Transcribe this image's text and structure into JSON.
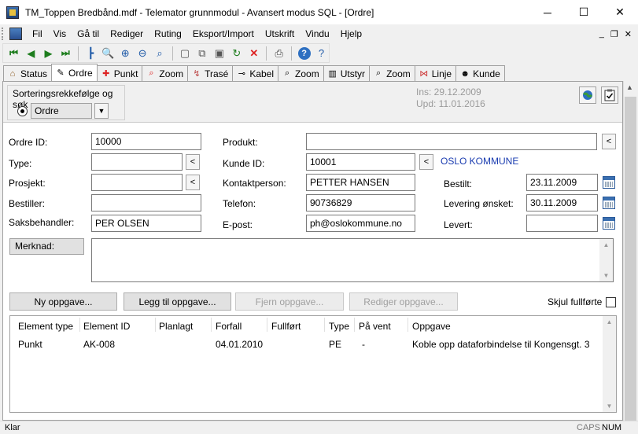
{
  "window": {
    "title": "TM_Toppen Bredbånd.mdf - Telemator grunnmodul - Avansert modus SQL - [Ordre]",
    "minimize": "─",
    "maximize": "☐",
    "close": "✕"
  },
  "menu": {
    "items": [
      "Fil",
      "Vis",
      "Gå til",
      "Rediger",
      "Ruting",
      "Eksport/Import",
      "Utskrift",
      "Vindu",
      "Hjelp"
    ],
    "mdi_min": "_",
    "mdi_restore": "❐",
    "mdi_close": "✕"
  },
  "toolbar": {
    "first": "⏮",
    "prev": "◀",
    "next": "▶",
    "last": "⏭",
    "tree": "┣",
    "zoom1": "🔍",
    "zoom2": "⊕",
    "zoom3": "⊖",
    "zoom4": "⌕",
    "new": "▢",
    "copy": "⧉",
    "save": "▣",
    "refresh": "↻",
    "delete": "✕",
    "print": "⎙",
    "help": "?",
    "whatsthis": "?"
  },
  "tabs": [
    {
      "label": "Status",
      "icon": "⌂"
    },
    {
      "label": "Ordre",
      "icon": "✎"
    },
    {
      "label": "Punkt",
      "icon": "✚"
    },
    {
      "label": "Zoom",
      "icon": "⌕"
    },
    {
      "label": "Trasé",
      "icon": "↯"
    },
    {
      "label": "Kabel",
      "icon": "⊸"
    },
    {
      "label": "Zoom",
      "icon": "⌕"
    },
    {
      "label": "Utstyr",
      "icon": "▥"
    },
    {
      "label": "Zoom",
      "icon": "⌕"
    },
    {
      "label": "Linje",
      "icon": "⋈"
    },
    {
      "label": "Kunde",
      "icon": "☻"
    }
  ],
  "sort": {
    "group_label": "Sorteringsrekkefølge og søk",
    "selected": "Ordre",
    "drop": "▼"
  },
  "meta": {
    "ins": "Ins: 29.12.2009",
    "upd": "Upd: 11.01.2016"
  },
  "form": {
    "ordre_id_label": "Ordre ID:",
    "ordre_id": "10000",
    "type_label": "Type:",
    "type": "",
    "prosjekt_label": "Prosjekt:",
    "prosjekt": "",
    "bestiller_label": "Bestiller:",
    "bestiller": "",
    "saksbehandler_label": "Saksbehandler:",
    "saksbehandler": "PER OLSEN",
    "produkt_label": "Produkt:",
    "produkt": "",
    "kunde_id_label": "Kunde ID:",
    "kunde_id": "10001",
    "kunde_name": "OSLO KOMMUNE",
    "kontaktperson_label": "Kontaktperson:",
    "kontaktperson": "PETTER HANSEN",
    "telefon_label": "Telefon:",
    "telefon": "90736829",
    "epost_label": "E-post:",
    "epost": "ph@oslokommune.no",
    "bestilt_label": "Bestilt:",
    "bestilt": "23.11.2009",
    "levering_label": "Levering ønsket:",
    "levering": "30.11.2009",
    "levert_label": "Levert:",
    "levert": "",
    "pick": "<",
    "merknad_label": "Merknad:",
    "merknad": ""
  },
  "actions": {
    "ny": "Ny oppgave...",
    "legg_til": "Legg til oppgave...",
    "fjern": "Fjern oppgave...",
    "rediger": "Rediger oppgave...",
    "skjul": "Skjul fullførte"
  },
  "grid": {
    "headers": [
      "Element type",
      "Element ID",
      "Planlagt",
      "Forfall",
      "Fullført",
      "Type",
      "På vent",
      "Oppgave"
    ],
    "rows": [
      [
        "Punkt",
        "AK-008",
        "",
        "04.01.2010",
        "",
        "PE",
        "-",
        "Koble opp dataforbindelse til Kongensgt. 3"
      ]
    ]
  },
  "status": {
    "text": "Klar",
    "caps": "CAPS",
    "num": "NUM"
  }
}
